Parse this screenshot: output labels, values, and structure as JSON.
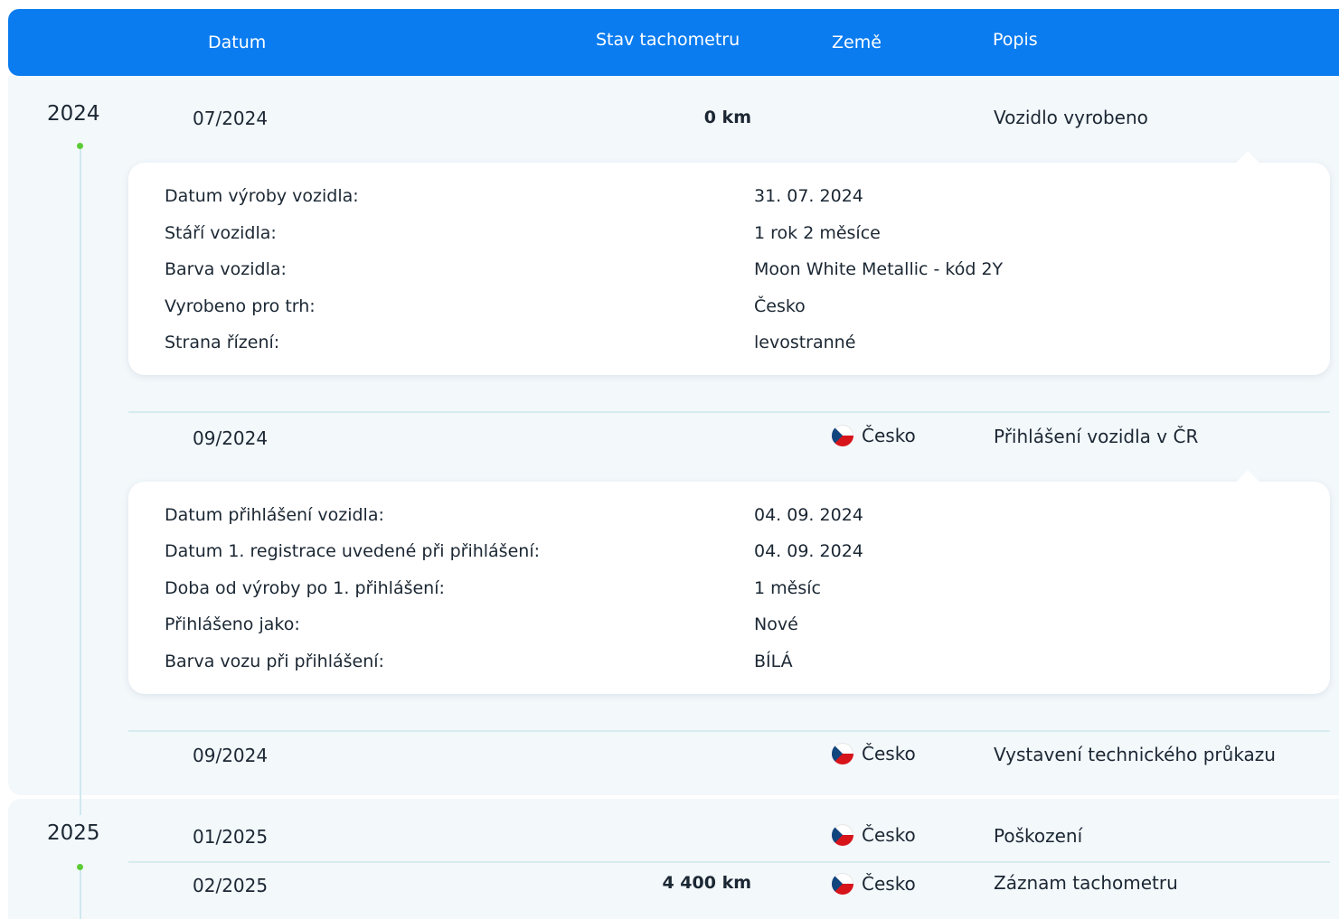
{
  "header": {
    "date": "Datum",
    "odometer": "Stav tachometru",
    "country": "Země",
    "description": "Popis"
  },
  "colors": {
    "header": "#0a7cf0",
    "section_bg": "#f3f8fb",
    "timeline_dot": "#5ccc36"
  },
  "years": [
    "2024",
    "2025"
  ],
  "events": [
    {
      "date": "07/2024",
      "odometer": "0 km",
      "country": "",
      "description": "Vozidlo vyrobeno"
    },
    {
      "date": "09/2024",
      "odometer": "",
      "country": "Česko",
      "description": "Přihlášení vozidla v ČR"
    },
    {
      "date": "09/2024",
      "odometer": "",
      "country": "Česko",
      "description": "Vystavení technického průkazu"
    },
    {
      "date": "01/2025",
      "odometer": "",
      "country": "Česko",
      "description": "Poškození"
    },
    {
      "date": "02/2025",
      "odometer": "4 400 km",
      "country": "Česko",
      "description": "Záznam tachometru"
    }
  ],
  "card1": [
    {
      "label": "Datum výroby vozidla:",
      "value": "31. 07. 2024"
    },
    {
      "label": "Stáří vozidla:",
      "value": "1 rok 2 měsíce"
    },
    {
      "label": "Barva vozidla:",
      "value": "Moon White Metallic - kód 2Y"
    },
    {
      "label": "Vyrobeno pro trh:",
      "value": "Česko"
    },
    {
      "label": "Strana řízení:",
      "value": "levostranné"
    }
  ],
  "card2": [
    {
      "label": "Datum přihlášení vozidla:",
      "value": "04. 09. 2024"
    },
    {
      "label": "Datum 1. registrace uvedené při přihlášení:",
      "value": "04. 09. 2024"
    },
    {
      "label": "Doba od výroby po 1. přihlášení:",
      "value": "1 měsíc"
    },
    {
      "label": "Přihlášeno jako:",
      "value": "Nové"
    },
    {
      "label": "Barva vozu při přihlášení:",
      "value": "BÍLÁ"
    }
  ],
  "icons": {
    "flag": "czech-flag-icon"
  }
}
